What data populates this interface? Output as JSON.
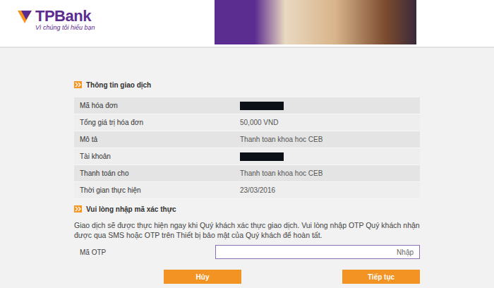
{
  "logo": {
    "brand": "TPBank",
    "tagline": "Vì chúng tôi hiểu bạn"
  },
  "transaction": {
    "title": "Thông tin giao dịch",
    "rows": [
      {
        "label": "Mã hóa đơn",
        "value": "",
        "redacted": true
      },
      {
        "label": "Tổng giá trị hóa đơn",
        "value": "50,000 VND",
        "redacted": false
      },
      {
        "label": "Mô tả",
        "value": "Thanh toan khoa hoc CEB",
        "redacted": false
      },
      {
        "label": "Tài khoản",
        "value": "",
        "redacted": true
      },
      {
        "label": "Thanh toán cho",
        "value": "Thanh toan khoa hoc CEB",
        "redacted": false
      },
      {
        "label": "Thời gian thực hiện",
        "value": "23/03/2016",
        "redacted": false
      }
    ]
  },
  "otp": {
    "title": "Vui lòng nhập mã xác thực",
    "instructions": "Giao dịch sẽ được thực hiện ngay khi Quý khách xác thực giao dịch. Vui lòng nhập OTP Quý khách nhận được qua SMS hoặc OTP trên Thiết bị bảo mật của Quý khách để hoàn tất.",
    "label": "Mã OTP",
    "placeholder": "Nhập"
  },
  "buttons": [
    {
      "label": "Hủy"
    },
    {
      "label": "Tiếp tục"
    }
  ]
}
